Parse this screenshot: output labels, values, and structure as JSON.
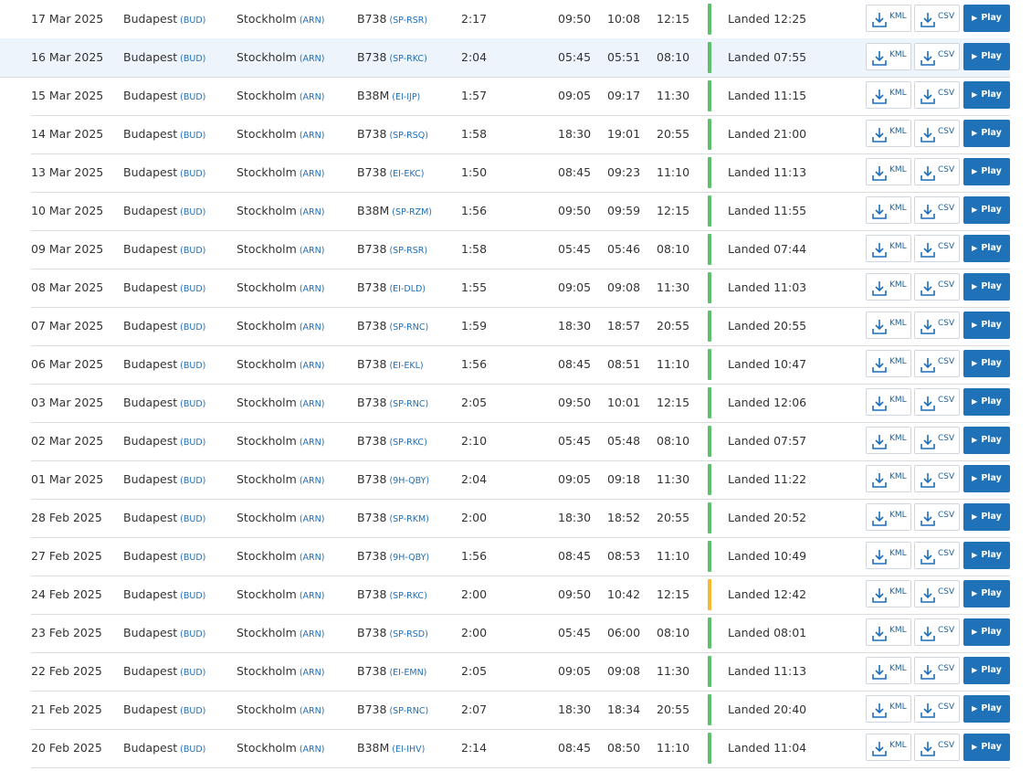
{
  "colors": {
    "ontime": "#5cc06d",
    "delayed": "#f5b82e",
    "link": "#1f6fb8",
    "play_bg": "#1f72b7"
  },
  "buttons": {
    "kml_label": "KML",
    "csv_label": "CSV",
    "play_label": "Play",
    "download_icon": "download-icon",
    "play_icon": "play-icon"
  },
  "flights": [
    {
      "date": "17 Mar 2025",
      "from": "Budapest",
      "from_code": "(BUD)",
      "to": "Stockholm",
      "to_code": "(ARN)",
      "aircraft": "B738",
      "reg": "(SP-RSR)",
      "duration": "2:17",
      "std": "09:50",
      "atd": "10:08",
      "sta": "12:15",
      "status": "Landed 12:25",
      "state": "ontime"
    },
    {
      "date": "16 Mar 2025",
      "from": "Budapest",
      "from_code": "(BUD)",
      "to": "Stockholm",
      "to_code": "(ARN)",
      "aircraft": "B738",
      "reg": "(SP-RKC)",
      "duration": "2:04",
      "std": "05:45",
      "atd": "05:51",
      "sta": "08:10",
      "status": "Landed 07:55",
      "state": "ontime"
    },
    {
      "date": "15 Mar 2025",
      "from": "Budapest",
      "from_code": "(BUD)",
      "to": "Stockholm",
      "to_code": "(ARN)",
      "aircraft": "B38M",
      "reg": "(EI-IJP)",
      "duration": "1:57",
      "std": "09:05",
      "atd": "09:17",
      "sta": "11:30",
      "status": "Landed 11:15",
      "state": "ontime"
    },
    {
      "date": "14 Mar 2025",
      "from": "Budapest",
      "from_code": "(BUD)",
      "to": "Stockholm",
      "to_code": "(ARN)",
      "aircraft": "B738",
      "reg": "(SP-RSQ)",
      "duration": "1:58",
      "std": "18:30",
      "atd": "19:01",
      "sta": "20:55",
      "status": "Landed 21:00",
      "state": "ontime"
    },
    {
      "date": "13 Mar 2025",
      "from": "Budapest",
      "from_code": "(BUD)",
      "to": "Stockholm",
      "to_code": "(ARN)",
      "aircraft": "B738",
      "reg": "(EI-EKC)",
      "duration": "1:50",
      "std": "08:45",
      "atd": "09:23",
      "sta": "11:10",
      "status": "Landed 11:13",
      "state": "ontime"
    },
    {
      "date": "10 Mar 2025",
      "from": "Budapest",
      "from_code": "(BUD)",
      "to": "Stockholm",
      "to_code": "(ARN)",
      "aircraft": "B38M",
      "reg": "(SP-RZM)",
      "duration": "1:56",
      "std": "09:50",
      "atd": "09:59",
      "sta": "12:15",
      "status": "Landed 11:55",
      "state": "ontime"
    },
    {
      "date": "09 Mar 2025",
      "from": "Budapest",
      "from_code": "(BUD)",
      "to": "Stockholm",
      "to_code": "(ARN)",
      "aircraft": "B738",
      "reg": "(SP-RSR)",
      "duration": "1:58",
      "std": "05:45",
      "atd": "05:46",
      "sta": "08:10",
      "status": "Landed 07:44",
      "state": "ontime"
    },
    {
      "date": "08 Mar 2025",
      "from": "Budapest",
      "from_code": "(BUD)",
      "to": "Stockholm",
      "to_code": "(ARN)",
      "aircraft": "B738",
      "reg": "(EI-DLD)",
      "duration": "1:55",
      "std": "09:05",
      "atd": "09:08",
      "sta": "11:30",
      "status": "Landed 11:03",
      "state": "ontime"
    },
    {
      "date": "07 Mar 2025",
      "from": "Budapest",
      "from_code": "(BUD)",
      "to": "Stockholm",
      "to_code": "(ARN)",
      "aircraft": "B738",
      "reg": "(SP-RNC)",
      "duration": "1:59",
      "std": "18:30",
      "atd": "18:57",
      "sta": "20:55",
      "status": "Landed 20:55",
      "state": "ontime"
    },
    {
      "date": "06 Mar 2025",
      "from": "Budapest",
      "from_code": "(BUD)",
      "to": "Stockholm",
      "to_code": "(ARN)",
      "aircraft": "B738",
      "reg": "(EI-EKL)",
      "duration": "1:56",
      "std": "08:45",
      "atd": "08:51",
      "sta": "11:10",
      "status": "Landed 10:47",
      "state": "ontime"
    },
    {
      "date": "03 Mar 2025",
      "from": "Budapest",
      "from_code": "(BUD)",
      "to": "Stockholm",
      "to_code": "(ARN)",
      "aircraft": "B738",
      "reg": "(SP-RNC)",
      "duration": "2:05",
      "std": "09:50",
      "atd": "10:01",
      "sta": "12:15",
      "status": "Landed 12:06",
      "state": "ontime"
    },
    {
      "date": "02 Mar 2025",
      "from": "Budapest",
      "from_code": "(BUD)",
      "to": "Stockholm",
      "to_code": "(ARN)",
      "aircraft": "B738",
      "reg": "(SP-RKC)",
      "duration": "2:10",
      "std": "05:45",
      "atd": "05:48",
      "sta": "08:10",
      "status": "Landed 07:57",
      "state": "ontime"
    },
    {
      "date": "01 Mar 2025",
      "from": "Budapest",
      "from_code": "(BUD)",
      "to": "Stockholm",
      "to_code": "(ARN)",
      "aircraft": "B738",
      "reg": "(9H-QBY)",
      "duration": "2:04",
      "std": "09:05",
      "atd": "09:18",
      "sta": "11:30",
      "status": "Landed 11:22",
      "state": "ontime"
    },
    {
      "date": "28 Feb 2025",
      "from": "Budapest",
      "from_code": "(BUD)",
      "to": "Stockholm",
      "to_code": "(ARN)",
      "aircraft": "B738",
      "reg": "(SP-RKM)",
      "duration": "2:00",
      "std": "18:30",
      "atd": "18:52",
      "sta": "20:55",
      "status": "Landed 20:52",
      "state": "ontime"
    },
    {
      "date": "27 Feb 2025",
      "from": "Budapest",
      "from_code": "(BUD)",
      "to": "Stockholm",
      "to_code": "(ARN)",
      "aircraft": "B738",
      "reg": "(9H-QBY)",
      "duration": "1:56",
      "std": "08:45",
      "atd": "08:53",
      "sta": "11:10",
      "status": "Landed 10:49",
      "state": "ontime"
    },
    {
      "date": "24 Feb 2025",
      "from": "Budapest",
      "from_code": "(BUD)",
      "to": "Stockholm",
      "to_code": "(ARN)",
      "aircraft": "B738",
      "reg": "(SP-RKC)",
      "duration": "2:00",
      "std": "09:50",
      "atd": "10:42",
      "sta": "12:15",
      "status": "Landed 12:42",
      "state": "delayed"
    },
    {
      "date": "23 Feb 2025",
      "from": "Budapest",
      "from_code": "(BUD)",
      "to": "Stockholm",
      "to_code": "(ARN)",
      "aircraft": "B738",
      "reg": "(SP-RSD)",
      "duration": "2:00",
      "std": "05:45",
      "atd": "06:00",
      "sta": "08:10",
      "status": "Landed 08:01",
      "state": "ontime"
    },
    {
      "date": "22 Feb 2025",
      "from": "Budapest",
      "from_code": "(BUD)",
      "to": "Stockholm",
      "to_code": "(ARN)",
      "aircraft": "B738",
      "reg": "(EI-EMN)",
      "duration": "2:05",
      "std": "09:05",
      "atd": "09:08",
      "sta": "11:30",
      "status": "Landed 11:13",
      "state": "ontime"
    },
    {
      "date": "21 Feb 2025",
      "from": "Budapest",
      "from_code": "(BUD)",
      "to": "Stockholm",
      "to_code": "(ARN)",
      "aircraft": "B738",
      "reg": "(SP-RNC)",
      "duration": "2:07",
      "std": "18:30",
      "atd": "18:34",
      "sta": "20:55",
      "status": "Landed 20:40",
      "state": "ontime"
    },
    {
      "date": "20 Feb 2025",
      "from": "Budapest",
      "from_code": "(BUD)",
      "to": "Stockholm",
      "to_code": "(ARN)",
      "aircraft": "B38M",
      "reg": "(EI-IHV)",
      "duration": "2:14",
      "std": "08:45",
      "atd": "08:50",
      "sta": "11:10",
      "status": "Landed 11:04",
      "state": "ontime"
    }
  ]
}
